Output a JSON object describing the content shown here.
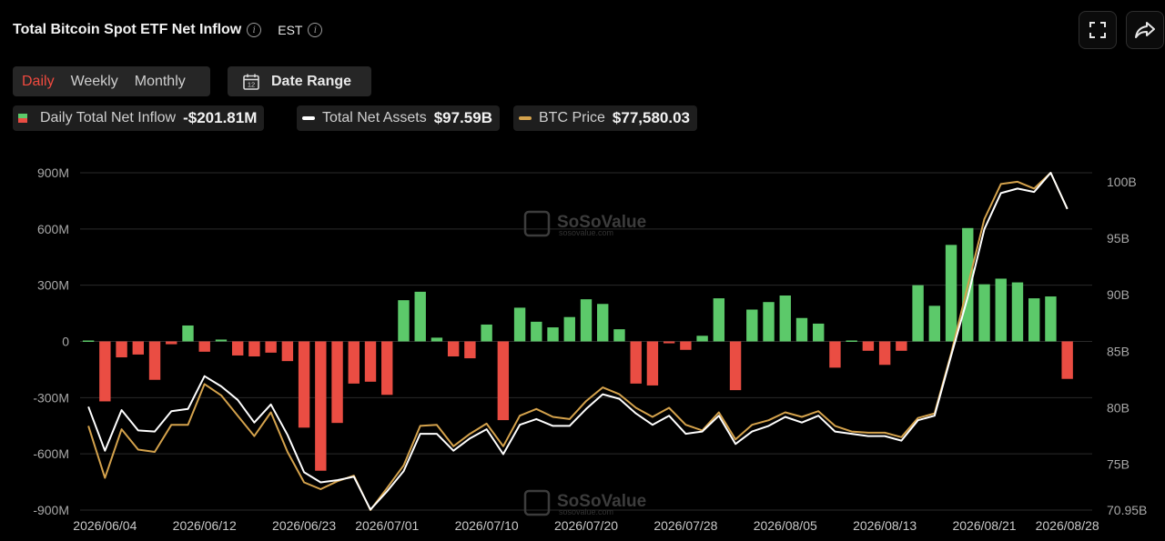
{
  "header": {
    "title": "Total Bitcoin Spot ETF Net Inflow",
    "timezone": "EST"
  },
  "tabs": [
    {
      "label": "Daily",
      "active": true
    },
    {
      "label": "Weekly",
      "active": false
    },
    {
      "label": "Monthly",
      "active": false
    }
  ],
  "date_range_label": "Date Range",
  "calendar_icon_text": "12",
  "legend": [
    {
      "name": "Daily Total Net Inflow",
      "value": "-$201.81M"
    },
    {
      "name": "Total Net Assets",
      "value": "$97.59B"
    },
    {
      "name": "BTC Price",
      "value": "$77,580.03"
    }
  ],
  "watermark": {
    "brand": "SoSoValue",
    "site": "sosovalue.com"
  },
  "colors": {
    "positive": "#5cc96a",
    "negative": "#ea4d43",
    "assets_line": "#ffffff",
    "price_line": "#d4a24c",
    "active_tab": "#f04a3f"
  },
  "chart_data": {
    "type": "bar",
    "left_axis": {
      "ticks": [
        900,
        600,
        300,
        0,
        -300,
        -600,
        -900
      ],
      "tick_labels": [
        "900M",
        "600M",
        "300M",
        "0",
        "-300M",
        "-600M",
        "-900M"
      ],
      "range": [
        -900,
        900
      ],
      "unit": "M USD"
    },
    "right_axis": {
      "ticks": [
        100,
        95,
        90,
        85,
        80,
        75,
        70.95
      ],
      "tick_labels": [
        "100B",
        "95B",
        "90B",
        "85B",
        "80B",
        "75B",
        "70.95B"
      ],
      "range": [
        70.95,
        100.8
      ],
      "unit": "B USD"
    },
    "x_tick_labels": [
      "2026/06/04",
      "2026/06/12",
      "2026/06/23",
      "2026/07/01",
      "2026/07/10",
      "2026/07/20",
      "2026/07/28",
      "2026/08/05",
      "2026/08/13",
      "2026/08/21",
      "2026/08/28"
    ],
    "x_tick_indices": [
      1,
      7,
      13,
      18,
      24,
      30,
      36,
      42,
      48,
      54,
      59
    ],
    "dates": [
      "2026/06/03",
      "2026/06/04",
      "2026/06/05",
      "2026/06/08",
      "2026/06/09",
      "2026/06/10",
      "2026/06/11",
      "2026/06/12",
      "2026/06/15",
      "2026/06/16",
      "2026/06/17",
      "2026/06/18",
      "2026/06/22",
      "2026/06/23",
      "2026/06/24",
      "2026/06/25",
      "2026/06/26",
      "2026/06/29",
      "2026/06/30",
      "2026/07/01",
      "2026/07/02",
      "2026/07/06",
      "2026/07/07",
      "2026/07/08",
      "2026/07/09",
      "2026/07/10",
      "2026/07/13",
      "2026/07/14",
      "2026/07/15",
      "2026/07/16",
      "2026/07/17",
      "2026/07/20",
      "2026/07/21",
      "2026/07/22",
      "2026/07/23",
      "2026/07/24",
      "2026/07/27",
      "2026/07/28",
      "2026/07/29",
      "2026/07/30",
      "2026/07/31",
      "2026/08/03",
      "2026/08/04",
      "2026/08/05",
      "2026/08/06",
      "2026/08/07",
      "2026/08/10",
      "2026/08/11",
      "2026/08/12",
      "2026/08/13",
      "2026/08/14",
      "2026/08/17",
      "2026/08/18",
      "2026/08/19",
      "2026/08/20",
      "2026/08/21",
      "2026/08/24",
      "2026/08/25",
      "2026/08/26",
      "2026/08/27",
      "2026/08/28"
    ],
    "series": [
      {
        "name": "Daily Total Net Inflow",
        "kind": "bar",
        "axis": "left",
        "values": [
          5,
          -320,
          -85,
          -70,
          -205,
          -15,
          85,
          -55,
          10,
          -75,
          -80,
          -60,
          -105,
          -460,
          -690,
          -435,
          -225,
          -215,
          -285,
          220,
          265,
          20,
          -80,
          -90,
          90,
          -420,
          180,
          105,
          75,
          130,
          225,
          200,
          65,
          -225,
          -235,
          -10,
          -45,
          30,
          230,
          -260,
          170,
          210,
          245,
          125,
          95,
          -140,
          5,
          -50,
          -125,
          -50,
          300,
          190,
          515,
          605,
          305,
          335,
          315,
          230,
          240,
          -200
        ],
        "colors": {
          "positive": "#5cc96a",
          "negative": "#ea4d43"
        }
      },
      {
        "name": "Total Net Assets",
        "kind": "line",
        "axis": "right",
        "values": [
          80.1,
          76.2,
          79.8,
          78.0,
          77.9,
          79.7,
          79.9,
          82.8,
          81.9,
          80.7,
          78.7,
          80.3,
          77.6,
          74.3,
          73.4,
          73.6,
          73.9,
          71.0,
          72.6,
          74.4,
          77.7,
          77.7,
          76.2,
          77.3,
          78.1,
          75.9,
          78.5,
          79.0,
          78.4,
          78.4,
          79.9,
          81.2,
          80.8,
          79.5,
          78.5,
          79.3,
          77.7,
          77.9,
          79.3,
          76.8,
          77.9,
          78.4,
          79.2,
          78.7,
          79.3,
          77.9,
          77.7,
          77.5,
          77.5,
          77.1,
          78.9,
          79.3,
          84.6,
          89.8,
          95.8,
          99.0,
          99.4,
          99.1,
          100.8,
          97.6
        ],
        "color": "#ffffff"
      },
      {
        "name": "BTC Price",
        "kind": "line",
        "axis": "right",
        "values": [
          78.4,
          73.8,
          78.1,
          76.3,
          76.1,
          78.5,
          78.5,
          82.1,
          81.1,
          79.3,
          77.5,
          79.6,
          76.1,
          73.4,
          72.8,
          73.5,
          74.0,
          70.95,
          72.9,
          74.9,
          78.4,
          78.5,
          76.6,
          77.7,
          78.6,
          76.6,
          79.3,
          79.9,
          79.2,
          79.0,
          80.6,
          81.8,
          81.2,
          80.0,
          79.2,
          80.0,
          78.5,
          78.0,
          79.6,
          77.2,
          78.5,
          78.9,
          79.6,
          79.2,
          79.7,
          78.4,
          77.9,
          77.8,
          77.8,
          77.4,
          79.1,
          79.5,
          84.8,
          90.8,
          96.7,
          99.8,
          100.0,
          99.4,
          100.8,
          97.6
        ],
        "color": "#d4a24c"
      }
    ],
    "grid": true,
    "legend_position": "top-left"
  }
}
